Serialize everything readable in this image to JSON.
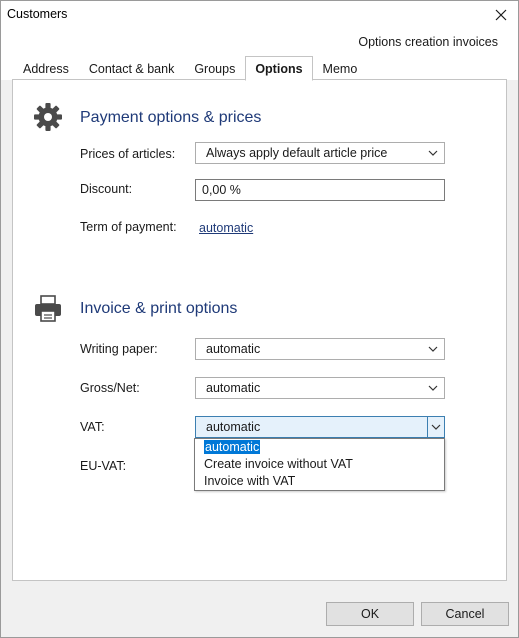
{
  "window": {
    "title": "Customers"
  },
  "header": {
    "link": "Options creation invoices"
  },
  "tabs": [
    {
      "label": "Address"
    },
    {
      "label": "Contact & bank"
    },
    {
      "label": "Groups"
    },
    {
      "label": "Options"
    },
    {
      "label": "Memo"
    }
  ],
  "payment": {
    "title": "Payment options & prices",
    "icon": "gear-icon",
    "prices_label": "Prices of articles:",
    "prices_value": "Always apply default article price",
    "discount_label": "Discount:",
    "discount_value": "0,00 %",
    "term_label": "Term of payment:",
    "term_value": "automatic"
  },
  "invoice": {
    "title": "Invoice & print options",
    "icon": "printer-icon",
    "writing_paper_label": "Writing paper:",
    "writing_paper_value": "automatic",
    "gross_net_label": "Gross/Net:",
    "gross_net_value": "automatic",
    "vat_label": "VAT:",
    "vat_value": "automatic",
    "vat_options": [
      "automatic",
      "Create invoice without VAT",
      "Invoice with VAT"
    ],
    "eu_vat_label": "EU-VAT:"
  },
  "footer": {
    "ok_label": "OK",
    "cancel_label": "Cancel"
  },
  "colors": {
    "accent": "#1f3a78",
    "selection": "#0078d7"
  }
}
